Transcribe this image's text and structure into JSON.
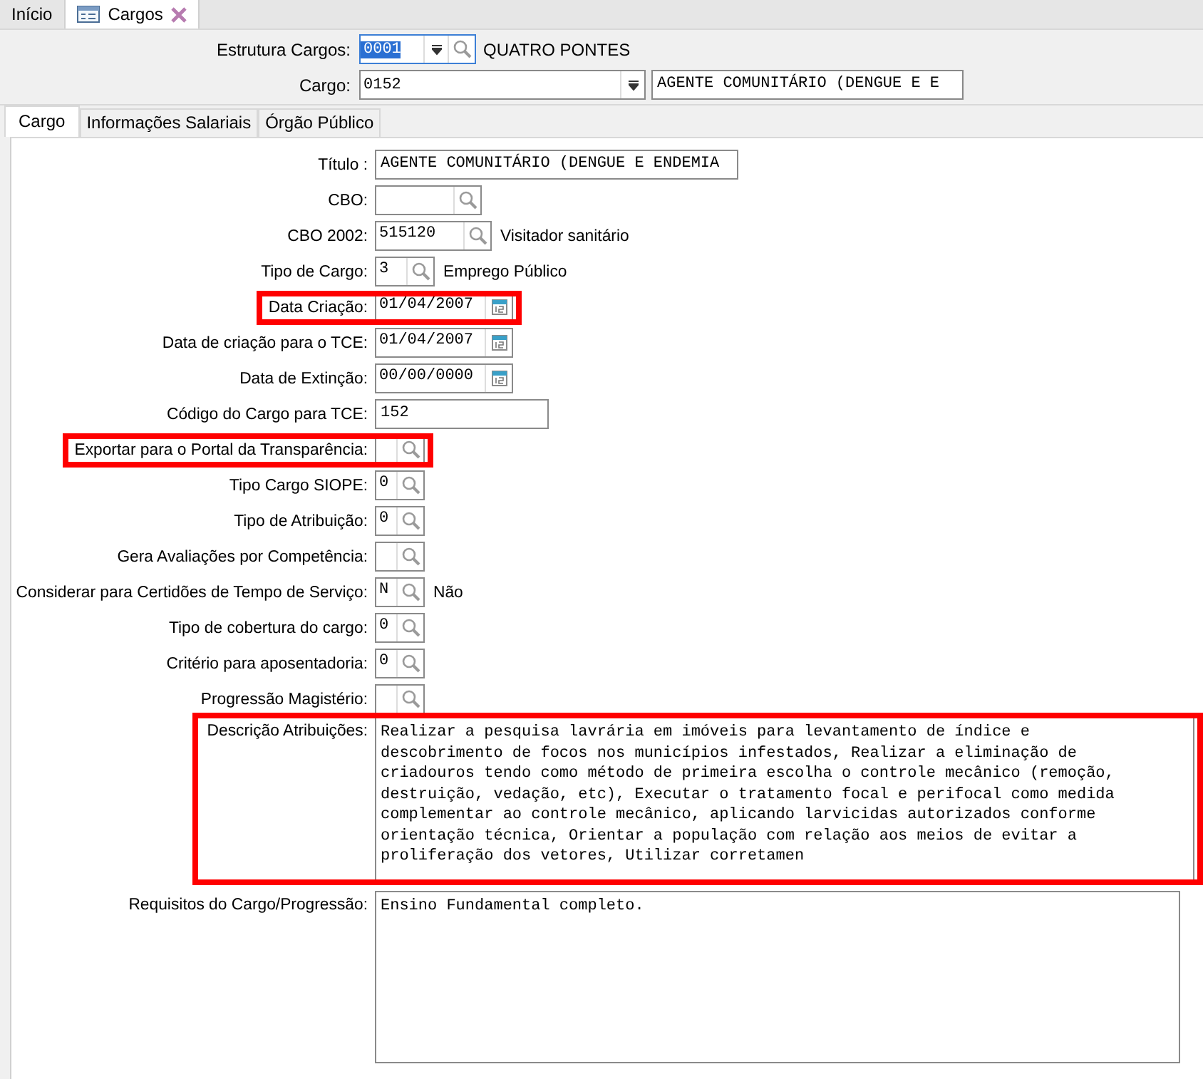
{
  "tabs": [
    {
      "label": "Início",
      "selected": false,
      "closable": false
    },
    {
      "label": "Cargos",
      "selected": true,
      "closable": true
    }
  ],
  "header": {
    "estrutura": {
      "label": "Estrutura Cargos:",
      "value": "0001",
      "value_selected": true,
      "description": "QUATRO PONTES"
    },
    "cargo": {
      "label": "Cargo:",
      "value": "0152",
      "description": "AGENTE COMUNITÁRIO (DENGUE E E"
    }
  },
  "subtabs": [
    {
      "label": "Cargo",
      "selected": true
    },
    {
      "label": "Informações Salariais",
      "selected": false
    },
    {
      "label": "Órgão Público",
      "selected": false
    }
  ],
  "fields": [
    {
      "kind": "text",
      "label": "Título :",
      "value": "AGENTE COMUNITÁRIO (DENGUE E ENDEMIA",
      "highlighted": false
    },
    {
      "kind": "lookup",
      "label": "CBO:",
      "highlighted": false
    },
    {
      "kind": "lookup",
      "label": "CBO 2002:",
      "value": "515120",
      "description": "Visitador sanitário",
      "highlighted": false
    },
    {
      "kind": "lookup",
      "label": "Tipo de Cargo:",
      "value": "3",
      "description": "Emprego Público",
      "highlighted": false
    },
    {
      "kind": "date",
      "label": "Data Criação:",
      "value": "01/04/2007",
      "highlighted": true
    },
    {
      "kind": "date",
      "label": "Data de criação para o TCE:",
      "value": "01/04/2007",
      "highlighted": false
    },
    {
      "kind": "date",
      "label": "Data de Extinção:",
      "value": "00/00/0000",
      "highlighted": false
    },
    {
      "kind": "text",
      "label": "Código do Cargo para TCE:",
      "value": "152",
      "highlighted": false
    },
    {
      "kind": "lookup",
      "label": "Exportar para o Portal da Transparência:",
      "highlighted": true
    },
    {
      "kind": "lookup",
      "label": "Tipo Cargo SIOPE:",
      "value": "0",
      "highlighted": false
    },
    {
      "kind": "lookup",
      "label": "Tipo de Atribuição:",
      "value": "0",
      "highlighted": false
    },
    {
      "kind": "lookup",
      "label": "Gera Avaliações por Competência:",
      "highlighted": false
    },
    {
      "kind": "lookup",
      "label": "Considerar para Certidões de Tempo de Serviço:",
      "value": "N",
      "description": "Não",
      "highlighted": false
    },
    {
      "kind": "lookup",
      "label": "Tipo de cobertura do cargo:",
      "value": "0",
      "highlighted": false
    },
    {
      "kind": "lookup",
      "label": "Critério para aposentadoria:",
      "value": "0",
      "highlighted": false
    },
    {
      "kind": "lookup",
      "label": "Progressão Magistério:",
      "highlighted": false
    },
    {
      "kind": "textarea",
      "label": "Descrição Atribuições:",
      "value": "Realizar a pesquisa lavrária em imóveis para levantamento de índice e descobrimento de focos nos municípios infestados, Realizar a eliminação de criadouros tendo como método de primeira escolha o controle mecânico (remoção, destruição, vedação, etc), Executar o tratamento focal e perifocal como medida complementar ao controle mecânico, aplicando larvicidas autorizados conforme orientação técnica, Orientar a população com relação aos meios de evitar a proliferação dos vetores, Utilizar corretamen",
      "highlighted": true
    },
    {
      "kind": "textarea",
      "label": "Requisitos do Cargo/Progressão:",
      "value": "Ensino Fundamental completo.",
      "highlighted": false
    }
  ]
}
